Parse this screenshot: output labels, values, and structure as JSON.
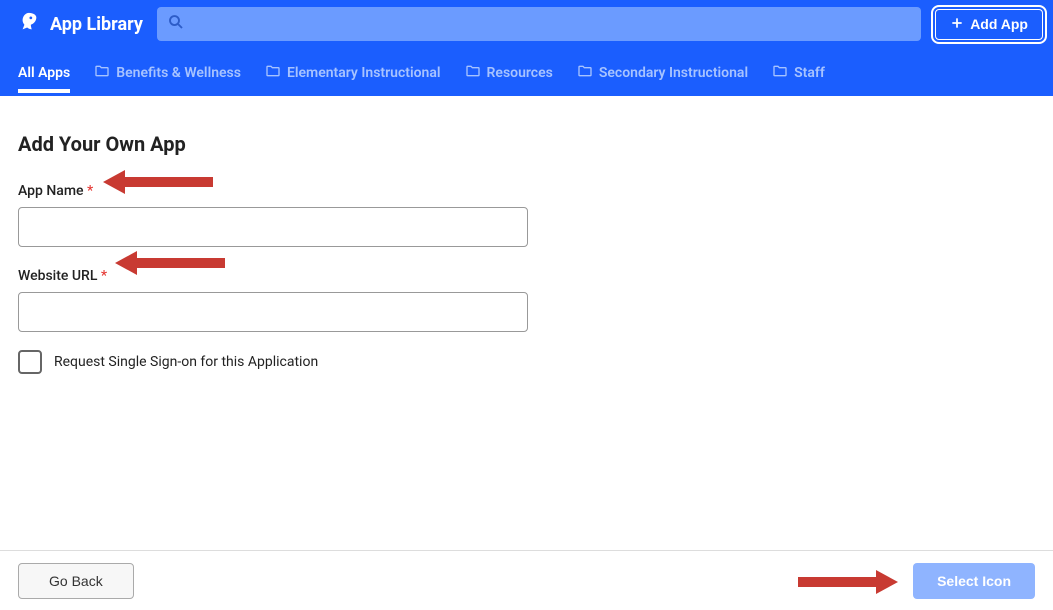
{
  "header": {
    "title": "App Library",
    "search_placeholder": "",
    "add_app_label": "Add App"
  },
  "tabs": [
    {
      "label": "All Apps",
      "active": true,
      "has_icon": false
    },
    {
      "label": "Benefits & Wellness",
      "active": false,
      "has_icon": true
    },
    {
      "label": "Elementary Instructional",
      "active": false,
      "has_icon": true
    },
    {
      "label": "Resources",
      "active": false,
      "has_icon": true
    },
    {
      "label": "Secondary Instructional",
      "active": false,
      "has_icon": true
    },
    {
      "label": "Staff",
      "active": false,
      "has_icon": true
    }
  ],
  "main": {
    "page_title": "Add Your Own App",
    "app_name_label": "App Name",
    "app_name_value": "",
    "website_url_label": "Website URL",
    "website_url_value": "",
    "sso_checkbox_label": "Request Single Sign-on for this Application",
    "sso_checked": false
  },
  "footer": {
    "go_back_label": "Go Back",
    "select_icon_label": "Select Icon"
  }
}
